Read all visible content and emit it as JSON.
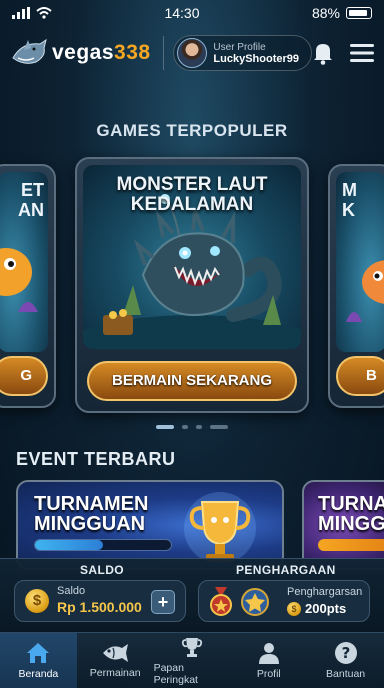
{
  "status": {
    "time": "14:30",
    "battery": "88%"
  },
  "header": {
    "logo": {
      "word": "vegas",
      "number": "338"
    },
    "profile": {
      "label": "User Profile",
      "name": "LuckyShooter99"
    }
  },
  "games": {
    "title": "GAMES TERPOPULER",
    "cards": [
      {
        "title_line1": "MONSTER LAUT",
        "title_line2": "KEDALAMAN",
        "button": "BERMAIN SEKARANG"
      }
    ],
    "side_left": {
      "title_line1": "ET",
      "title_line2": "AN",
      "button": "G"
    },
    "side_right": {
      "title_line1": "M",
      "title_line2": "K",
      "button": "B"
    }
  },
  "events": {
    "title": "EVENT TERBARU",
    "main": {
      "title_line1": "TURNAMEN",
      "title_line2": "MINGGUAN",
      "progress": 0.5
    },
    "side": {
      "title_line1": "TURNA",
      "title_line2": "MINGG"
    }
  },
  "wallet": {
    "saldo_header": "SALDO",
    "saldo_label": "Saldo",
    "saldo_value": "Rp 1.500.000",
    "add_label": "+",
    "coin_symbol": "$",
    "award_header": "PENGHARGAAN",
    "award_label": "Penghargarsan",
    "award_value": "200pts"
  },
  "tabs": [
    {
      "label": "Beranda",
      "icon": "home-icon",
      "active": true
    },
    {
      "label": "Permainan",
      "icon": "fish-icon"
    },
    {
      "label": "Papan Peringkat",
      "icon": "trophy-icon"
    },
    {
      "label": "Profil",
      "icon": "user-icon"
    },
    {
      "label": "Bantuan",
      "icon": "help-icon"
    }
  ],
  "colors": {
    "accent": "#f5a623",
    "button": "#d58a24",
    "active_tab": "#22476a"
  }
}
